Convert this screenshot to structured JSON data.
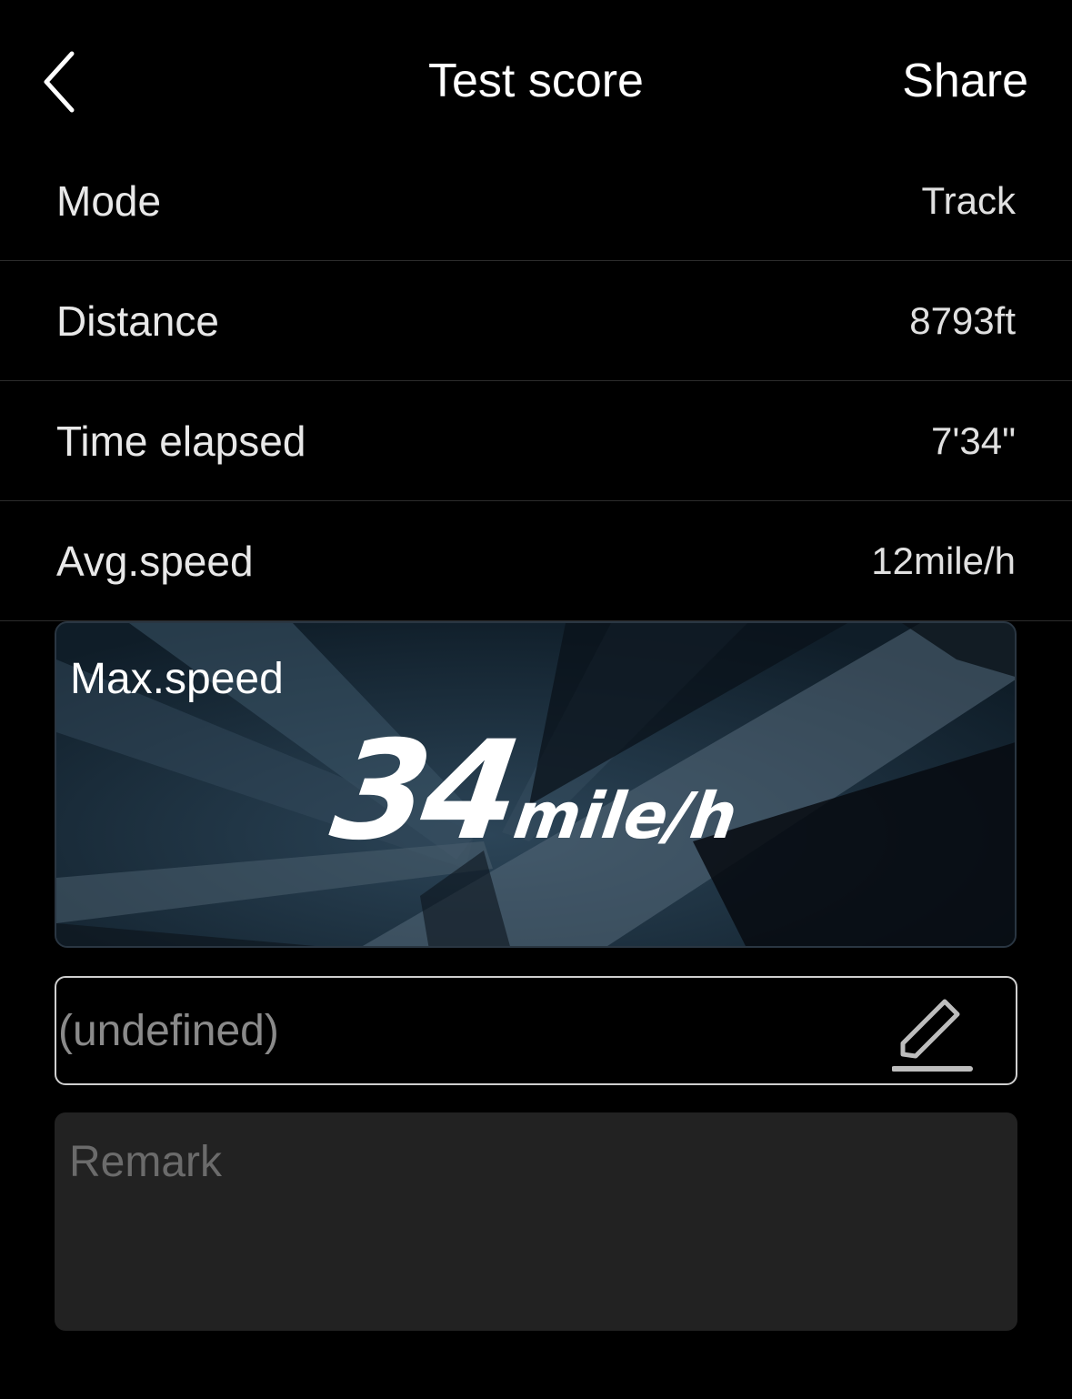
{
  "header": {
    "title": "Test score",
    "back_icon": "chevron-left-icon",
    "share_label": "Share"
  },
  "rows": [
    {
      "label": "Mode",
      "value": "Track"
    },
    {
      "label": "Distance",
      "value": "8793ft"
    },
    {
      "label": "Time elapsed",
      "value": "7'34\""
    },
    {
      "label": "Avg.speed",
      "value": "12mile/h"
    }
  ],
  "max_speed": {
    "label": "Max.speed",
    "value": "34",
    "unit": "mile/h"
  },
  "name_field": {
    "value": "(undefined)",
    "edit_icon": "pencil-edit-icon"
  },
  "remark": {
    "placeholder": "Remark"
  },
  "colors": {
    "background": "#000000",
    "card_base": "#142330",
    "row_divider": "#2c2c2c",
    "remark_bg": "#222222"
  }
}
